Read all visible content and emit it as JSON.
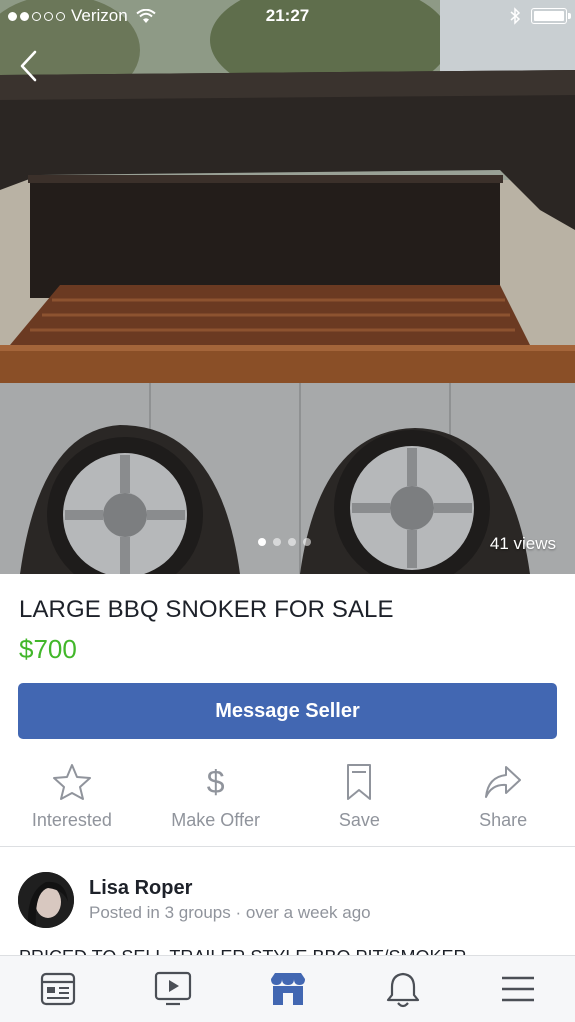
{
  "status_bar": {
    "carrier": "Verizon",
    "time": "21:27",
    "signal_dots_filled": 2,
    "signal_dots_total": 5
  },
  "listing": {
    "title": "LARGE BBQ SNOKER FOR SALE",
    "price": "$700",
    "views": "41 views",
    "photo_pager": {
      "count": 4,
      "active_index": 0
    },
    "description_preview": "PRICED TO SELL TRAILER STYLE BBQ PIT/SMOKER"
  },
  "message_button": {
    "label": "Message Seller"
  },
  "actions": [
    {
      "label": "Interested",
      "icon": "star-icon"
    },
    {
      "label": "Make Offer",
      "icon": "dollar-icon"
    },
    {
      "label": "Save",
      "icon": "bookmark-icon"
    },
    {
      "label": "Share",
      "icon": "share-arrow-icon"
    }
  ],
  "seller": {
    "name": "Lisa Roper",
    "meta": "Posted in 3 groups · over a week ago"
  },
  "tabbar": [
    {
      "icon": "news-feed-icon",
      "active": false
    },
    {
      "icon": "video-icon",
      "active": false
    },
    {
      "icon": "marketplace-icon",
      "active": true
    },
    {
      "icon": "notifications-bell-icon",
      "active": false
    },
    {
      "icon": "menu-icon",
      "active": false
    }
  ],
  "colors": {
    "accent": "#4267b2",
    "price": "#42b72a",
    "secondary_text": "#90949c"
  }
}
